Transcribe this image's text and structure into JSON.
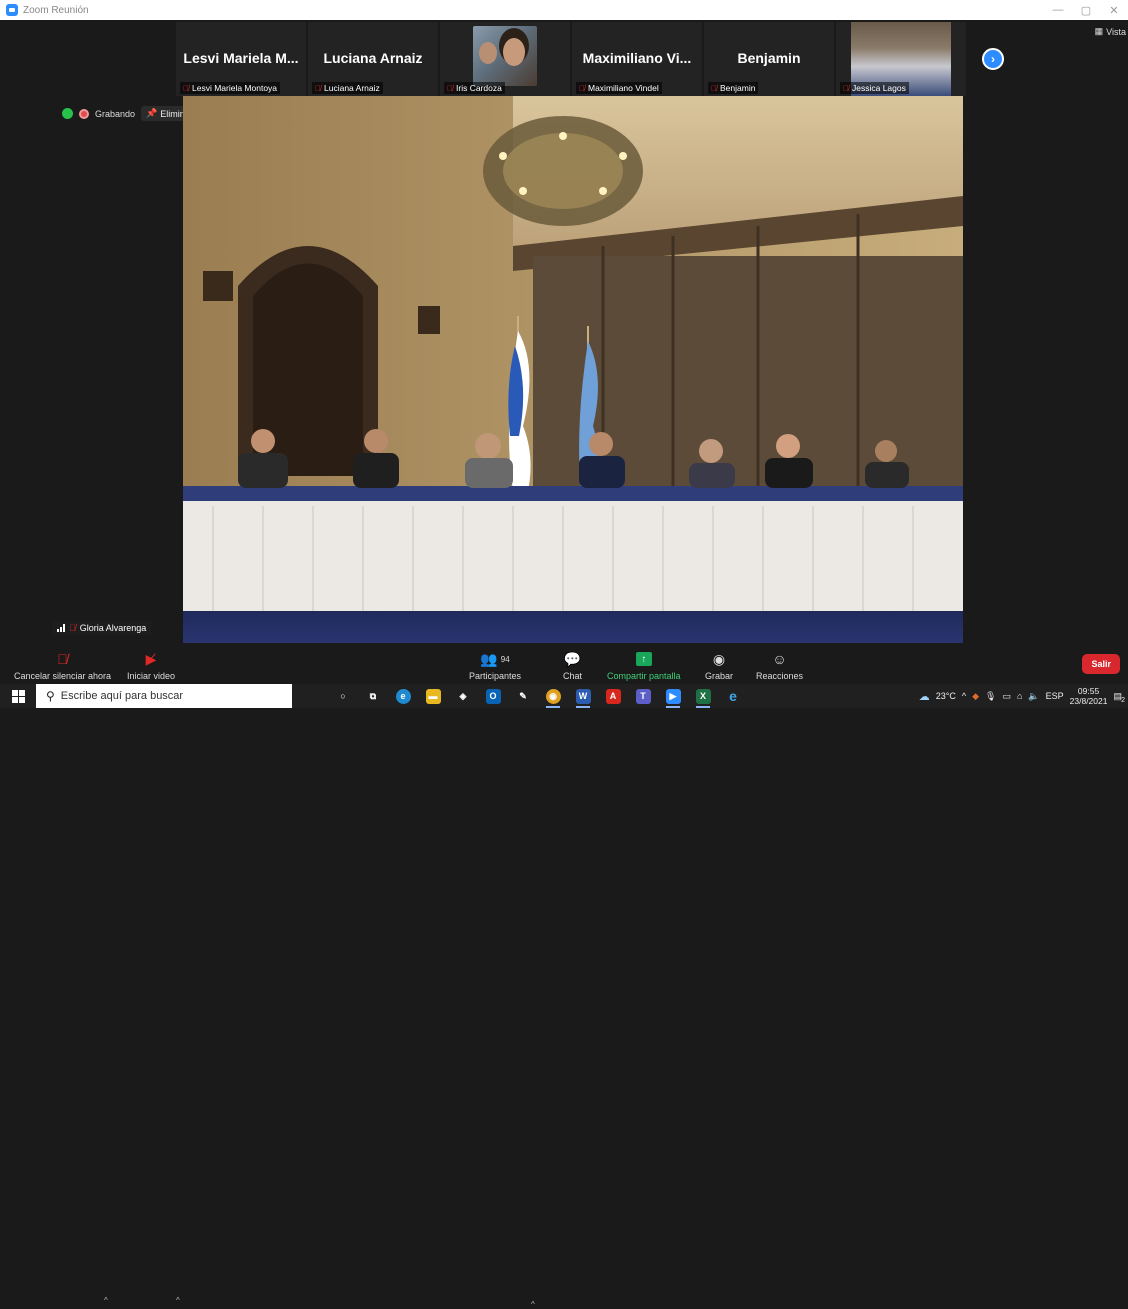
{
  "window": {
    "title": "Zoom Reunión",
    "controls": [
      "—",
      "▢",
      "✕"
    ]
  },
  "view_button": {
    "label": "Vista"
  },
  "recording": {
    "label": "Grabando",
    "unpin_label": "Eliminar anclaje"
  },
  "participants_strip": [
    {
      "display": "Lesvi  Mariela  M...",
      "name": "Lesvi Mariela Montoya",
      "video": false
    },
    {
      "display": "Luciana Arnaiz",
      "name": "Luciana Arnaiz",
      "video": false
    },
    {
      "display": "",
      "name": "Iris Cardoza",
      "video": "face"
    },
    {
      "display": "Maximiliano  Vi...",
      "name": "Maximiliano Vindel",
      "video": false
    },
    {
      "display": "Benjamin",
      "name": "Benjamin",
      "video": false
    },
    {
      "display": "",
      "name": "Jessica Lagos",
      "video": "room"
    }
  ],
  "active_speaker": {
    "name": "Gloria Alvarenga"
  },
  "toolbar": {
    "mute_label": "Cancelar silenciar ahora",
    "video_label": "Iniciar video",
    "participants_label": "Participantes",
    "participants_count": "94",
    "chat_label": "Chat",
    "share_label": "Compartir pantalla",
    "record_label": "Grabar",
    "reactions_label": "Reacciones",
    "leave_label": "Salir"
  },
  "taskbar": {
    "search_placeholder": "Escribe aquí para buscar",
    "apps": [
      {
        "name": "cortana-icon",
        "glyph": "○",
        "color": "transparent"
      },
      {
        "name": "task-view-icon",
        "glyph": "⧉",
        "color": "transparent"
      },
      {
        "name": "edge-icon",
        "glyph": "e",
        "color": "#1f8ad2"
      },
      {
        "name": "file-explorer-icon",
        "glyph": "▬",
        "color": "#e8b820"
      },
      {
        "name": "app-icon",
        "glyph": "◈",
        "color": "transparent"
      },
      {
        "name": "outlook-icon",
        "glyph": "O",
        "color": "#0a64b5"
      },
      {
        "name": "paint-icon",
        "glyph": "✎",
        "color": "transparent"
      },
      {
        "name": "chrome-icon",
        "glyph": "◉",
        "color": "#e0a020"
      },
      {
        "name": "word-icon",
        "glyph": "W",
        "color": "#2b5cb0"
      },
      {
        "name": "acrobat-icon",
        "glyph": "A",
        "color": "#d8281e"
      },
      {
        "name": "teams-icon",
        "glyph": "T",
        "color": "#5b5fc7"
      },
      {
        "name": "zoom-icon",
        "glyph": "▶",
        "color": "#2d8cff"
      },
      {
        "name": "excel-icon",
        "glyph": "X",
        "color": "#1e7145"
      },
      {
        "name": "ie-icon",
        "glyph": "e",
        "color": "transparent"
      }
    ],
    "temperature": "23°C",
    "language": "ESP",
    "time": "09:55",
    "date": "23/8/2021",
    "notification_count": "2"
  },
  "colors": {
    "zoom_blue": "#2d8cff",
    "leave_red": "#d9272e",
    "share_green": "#19a55a",
    "muted_red": "#e02828"
  }
}
